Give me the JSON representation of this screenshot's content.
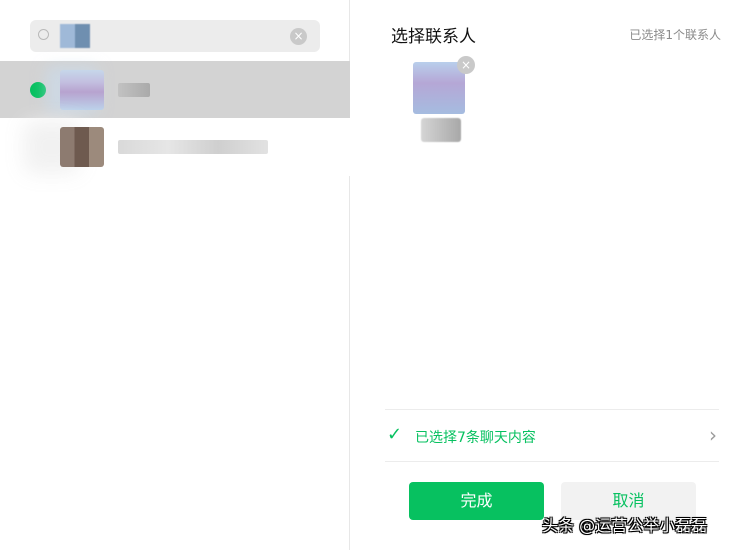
{
  "search": {
    "clear_icon": "×"
  },
  "contacts": [
    {
      "selected": true
    },
    {
      "selected": false
    }
  ],
  "panel": {
    "title": "选择联系人",
    "selected_count": "已选择1个联系人",
    "remove_icon": "×",
    "content_summary": "已选择7条聊天内容",
    "check_icon": "✓",
    "chevron_icon": "›"
  },
  "buttons": {
    "done": "完成",
    "cancel": "取消"
  },
  "watermark": "头条 @运营公举小磊磊",
  "colors": {
    "accent": "#07c160",
    "selected_row": "#d3d3d3"
  }
}
